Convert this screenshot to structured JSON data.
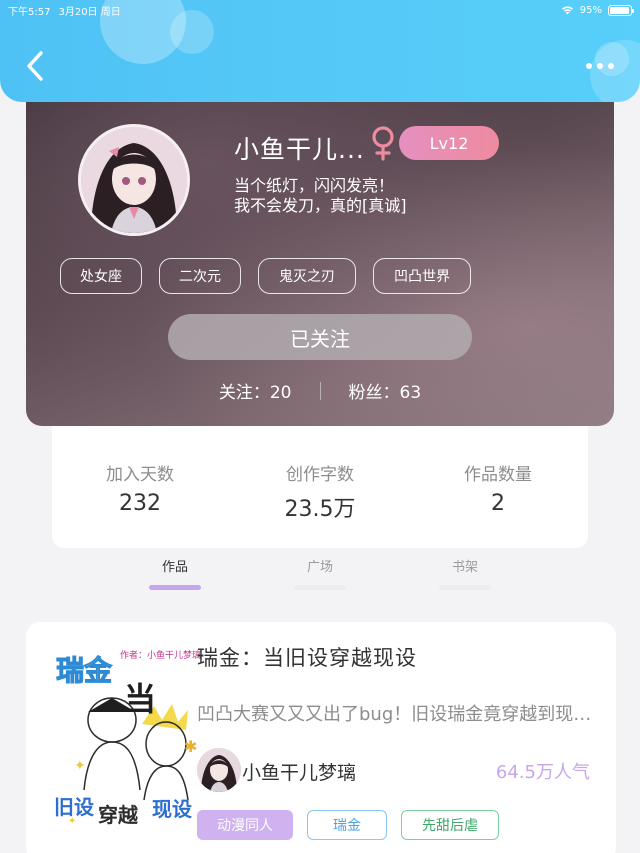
{
  "status_bar": {
    "time": "下午5:57",
    "date": "3月20日 周日",
    "battery": "95%",
    "battery_level": 0.95
  },
  "profile": {
    "username": "小鱼干儿...",
    "level": "Lv12",
    "bio_line1": "当个纸灯，闪闪发亮！",
    "bio_line2": "我不会发刀，真的[真诚]",
    "tags": [
      "处女座",
      "二次元",
      "鬼灭之刃",
      "凹凸世界"
    ],
    "follow_label": "已关注",
    "following_label": "关注：",
    "following_count": "20",
    "followers_label": "粉丝：",
    "followers_count": "63",
    "accent_color": "#ee8b9e"
  },
  "stats": {
    "days_label": "加入天数",
    "days_value": "232",
    "words_label": "创作字数",
    "words_value": "23.5万",
    "works_label": "作品数量",
    "works_value": "2"
  },
  "tabs": [
    {
      "label": "作品",
      "active": true
    },
    {
      "label": "广场",
      "active": false
    },
    {
      "label": "书架",
      "active": false
    }
  ],
  "book": {
    "title": "瑞金：当旧设穿越现设",
    "description": "凹凸大赛又又又出了bug！旧设瑞金竟穿越到现设了！",
    "author": "小鱼干儿梦璃",
    "popularity": "64.5万人气",
    "tags": [
      "动漫同人",
      "瑞金",
      "先甜后虐"
    ],
    "cover": {
      "author_note": "作者：小鱼干儿梦璃",
      "big_left": "瑞金",
      "big_right": "当",
      "bottom_left": "旧设",
      "bottom_mid": "穿越",
      "bottom_right": "现设"
    },
    "accent_color": "#c7a6ec"
  },
  "icons": {
    "back": "chevron-left-icon",
    "more": "more-dots-icon",
    "gender": "female-icon",
    "wifi": "wifi-icon",
    "battery": "battery-icon"
  }
}
